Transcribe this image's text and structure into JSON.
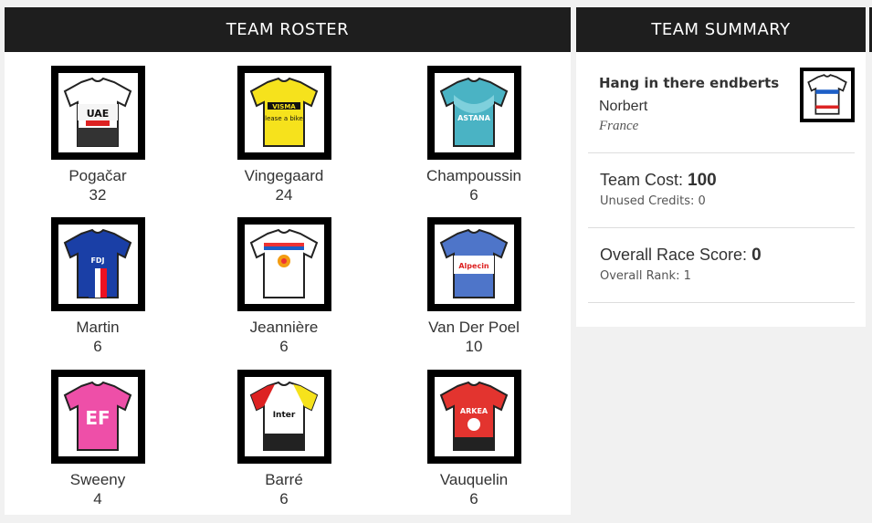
{
  "roster": {
    "title": "TEAM ROSTER",
    "riders": [
      {
        "name": "Pogačar",
        "score": "32",
        "jersey": "uae-jersey-icon"
      },
      {
        "name": "Vingegaard",
        "score": "24",
        "jersey": "visma-jersey-icon"
      },
      {
        "name": "Champoussin",
        "score": "6",
        "jersey": "astana-jersey-icon"
      },
      {
        "name": "Martin",
        "score": "6",
        "jersey": "groupama-jersey-icon"
      },
      {
        "name": "Jeannière",
        "score": "6",
        "jersey": "totalenergies-jersey-icon"
      },
      {
        "name": "Van Der Poel",
        "score": "10",
        "jersey": "alpecin-jersey-icon"
      },
      {
        "name": "Sweeny",
        "score": "4",
        "jersey": "ef-jersey-icon"
      },
      {
        "name": "Barré",
        "score": "6",
        "jersey": "intermarche-jersey-icon"
      },
      {
        "name": "Vauquelin",
        "score": "6",
        "jersey": "arkea-jersey-icon"
      }
    ]
  },
  "summary": {
    "title": "TEAM SUMMARY",
    "team_name": "Hang in there endberts",
    "owner": "Norbert",
    "country": "France",
    "cost_label": "Team Cost:",
    "cost_value": "100",
    "credits_text": "Unused Credits: 0",
    "score_label": "Overall Race Score:",
    "score_value": "0",
    "rank_text": "Overall Rank: 1"
  }
}
